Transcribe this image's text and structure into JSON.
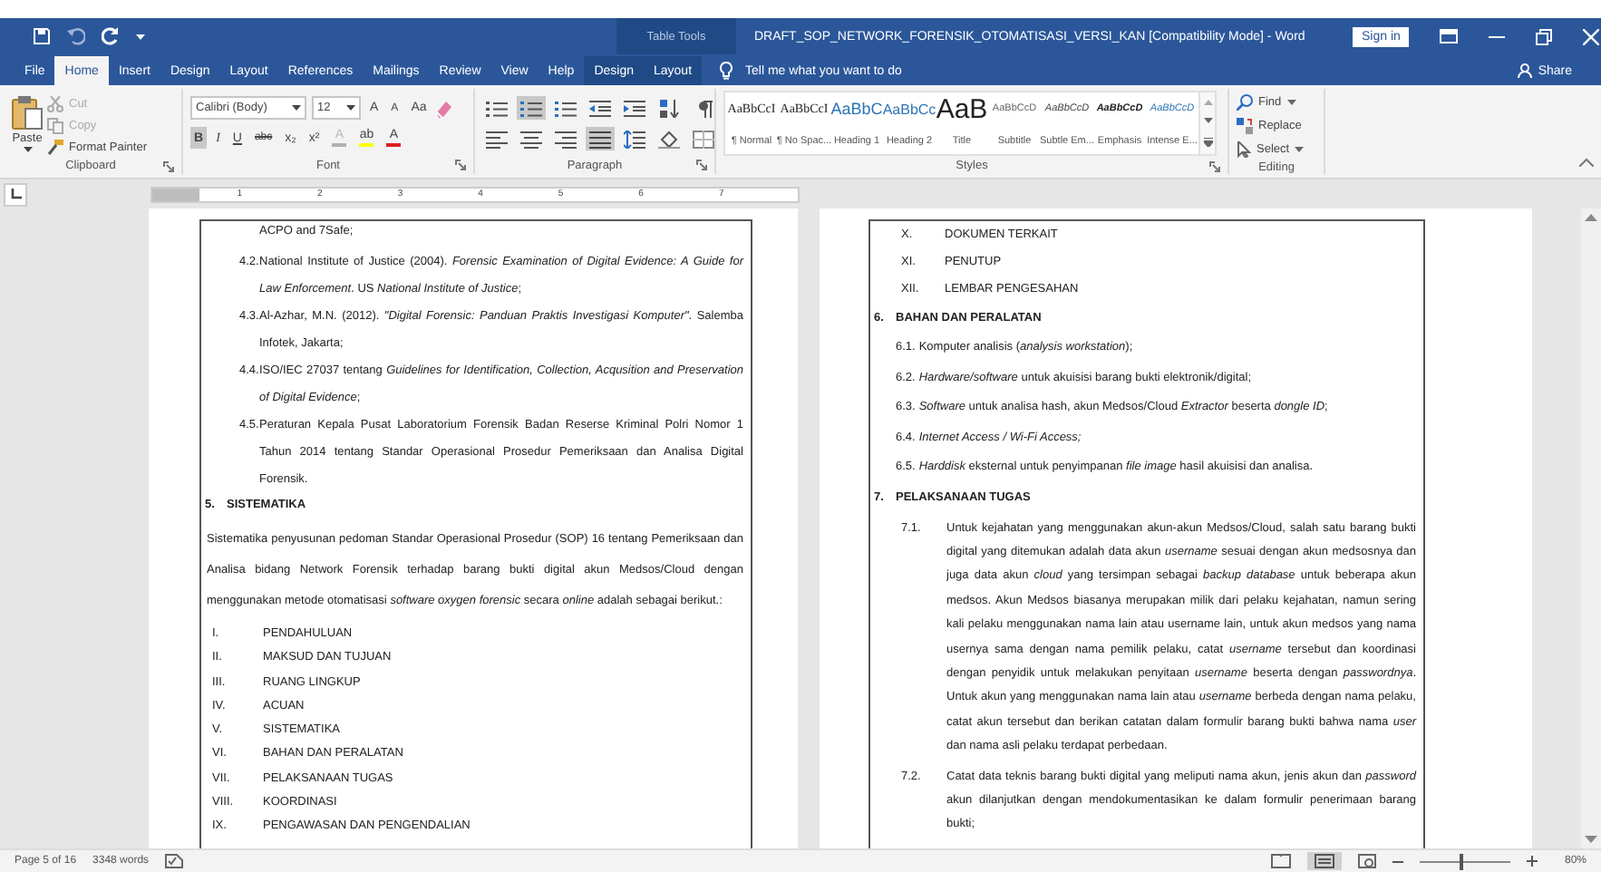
{
  "title_bar": {
    "contextual": "Table Tools",
    "title": "DRAFT_SOP_NETWORK_FORENSIK_OTOMATISASI_VERSI_KAN [Compatibility Mode]  -  Word",
    "sign_in": "Sign in"
  },
  "tabs": [
    {
      "label": "File",
      "selected": false,
      "kind": "file"
    },
    {
      "label": "Home",
      "selected": true,
      "kind": "normal"
    },
    {
      "label": "Insert",
      "selected": false,
      "kind": "normal"
    },
    {
      "label": "Design",
      "selected": false,
      "kind": "normal"
    },
    {
      "label": "Layout",
      "selected": false,
      "kind": "normal"
    },
    {
      "label": "References",
      "selected": false,
      "kind": "normal"
    },
    {
      "label": "Mailings",
      "selected": false,
      "kind": "normal"
    },
    {
      "label": "Review",
      "selected": false,
      "kind": "normal"
    },
    {
      "label": "View",
      "selected": false,
      "kind": "normal"
    },
    {
      "label": "Help",
      "selected": false,
      "kind": "normal"
    },
    {
      "label": "Design",
      "selected": false,
      "kind": "contextual"
    },
    {
      "label": "Layout",
      "selected": false,
      "kind": "contextual"
    }
  ],
  "tell_me": {
    "placeholder": "Tell me what you want to do"
  },
  "share": "Share",
  "clipboard": {
    "paste": "Paste",
    "cut": {
      "label": "Cut",
      "disabled": true
    },
    "copy": {
      "label": "Copy",
      "disabled": true
    },
    "format_painter": {
      "label": "Format Painter",
      "disabled": false
    },
    "label": "Clipboard"
  },
  "font": {
    "name": "Calibri (Body)",
    "size": "12",
    "label": "Font",
    "top_tools": [
      {
        "label": "A",
        "kind": "grow"
      },
      {
        "label": "A",
        "kind": "shrink"
      },
      {
        "label": "Aa",
        "kind": "case"
      }
    ],
    "buttons": [
      {
        "label": "B",
        "kind": "bold",
        "on": true
      },
      {
        "label": "I",
        "kind": "italic",
        "on": false
      },
      {
        "label": "U",
        "kind": "underline",
        "on": false
      },
      {
        "label": "abc",
        "kind": "strike",
        "on": false
      },
      {
        "label": "x₂",
        "kind": "sub",
        "on": false
      },
      {
        "label": "x²",
        "kind": "sup",
        "on": false
      }
    ],
    "colors": [
      {
        "label": "A",
        "kind": "effect",
        "color": "#b0b0b0"
      },
      {
        "label": "ab",
        "kind": "highlight",
        "color": "#ffff00"
      },
      {
        "label": "A",
        "kind": "fontcolor",
        "color": "#e02020"
      }
    ]
  },
  "paragraph": {
    "label": "Paragraph",
    "top": [
      {
        "kind": "bullets",
        "on": false
      },
      {
        "kind": "numbering",
        "on": true
      },
      {
        "kind": "multilevel",
        "on": false
      },
      {
        "kind": "outdent",
        "on": false
      },
      {
        "kind": "indent",
        "on": false
      },
      {
        "kind": "sort",
        "on": false
      },
      {
        "kind": "pilcrow",
        "on": false
      }
    ],
    "bottom": [
      {
        "kind": "left",
        "on": false
      },
      {
        "kind": "center",
        "on": false
      },
      {
        "kind": "right",
        "on": false
      },
      {
        "kind": "justify",
        "on": true
      },
      {
        "kind": "spacing",
        "on": false
      },
      {
        "kind": "shading",
        "on": false
      },
      {
        "kind": "borders",
        "on": false
      }
    ]
  },
  "styles": {
    "label": "Styles",
    "items": [
      {
        "preview": "AaBbCcI",
        "name": "¶ Normal",
        "kind": "normal"
      },
      {
        "preview": "AaBbCcI",
        "name": "¶ No Spac...",
        "kind": "normal"
      },
      {
        "preview": "AaBbC",
        "name": "Heading 1",
        "kind": "heading1"
      },
      {
        "preview": "AaBbCc",
        "name": "Heading 2",
        "kind": "heading2"
      },
      {
        "preview": "AaB",
        "name": "Title",
        "kind": "title"
      },
      {
        "preview": "AaBbCcD",
        "name": "Subtitle",
        "kind": "subtitle"
      },
      {
        "preview": "AaBbCcD",
        "name": "Subtle Em...",
        "kind": "subtle"
      },
      {
        "preview": "AaBbCcD",
        "name": "Emphasis",
        "kind": "emphasis"
      },
      {
        "preview": "AaBbCcD",
        "name": "Intense E...",
        "kind": "intense"
      }
    ]
  },
  "editing": {
    "label": "Editing",
    "find": "Find",
    "replace": "Replace",
    "select": "Select"
  },
  "ruler": [
    "1",
    "2",
    "3",
    "4",
    "5",
    "6",
    "7"
  ],
  "left_page": [
    {
      "kind": "cont",
      "text": "ACPO and 7Safe;"
    },
    {
      "kind": "ref",
      "number": "4.2.",
      "text": "National Institute of Justice (2004). *Forensic Examination of Digital Evidence: A Guide for Law Enforcement*. US *National Institute of Justice*;"
    },
    {
      "kind": "ref",
      "number": "4.3.",
      "text": "Al-Azhar, M.N. (2012). *\"Digital Forensic: Panduan Praktis Investigasi Komputer\"*. Salemba Infotek, Jakarta;"
    },
    {
      "kind": "ref",
      "number": "4.4.",
      "text": "ISO/IEC 27037 tentang *Guidelines for Identification, Collection, Acqusition and Preservation of Digital Evidence*;"
    },
    {
      "kind": "ref",
      "number": "4.5.",
      "text": "Peraturan Kepala Pusat Laboratorium Forensik Badan Reserse Kriminal Polri Nomor 1 Tahun 2014 tentang Standar Operasional Prosedur Pemeriksaan dan Analisa Digital Forensik."
    },
    {
      "kind": "heading",
      "number": "5.",
      "text": "SISTEMATIKA"
    },
    {
      "kind": "para",
      "text": "Sistematika penyusunan pedoman Standar Operasional Prosedur (SOP) 16 tentang Pemeriksaan dan Analisa bidang Network Forensik terhadap barang bukti digital akun Medsos/Cloud dengan menggunakan metode otomatisasi *software oxygen forensic* secara *online* adalah sebagai berikut.:"
    },
    {
      "kind": "roman",
      "number": "I.",
      "text": "PENDAHULUAN"
    },
    {
      "kind": "roman",
      "number": "II.",
      "text": "MAKSUD DAN TUJUAN"
    },
    {
      "kind": "roman",
      "number": "III.",
      "text": "RUANG LINGKUP"
    },
    {
      "kind": "roman",
      "number": "IV.",
      "text": "ACUAN"
    },
    {
      "kind": "roman",
      "number": "V.",
      "text": "SISTEMATIKA"
    },
    {
      "kind": "roman",
      "number": "VI.",
      "text": "BAHAN DAN PERALATAN"
    },
    {
      "kind": "roman",
      "number": "VII.",
      "text": "PELAKSANAAN TUGAS"
    },
    {
      "kind": "roman",
      "number": "VIII.",
      "text": "KOORDINASI"
    },
    {
      "kind": "roman",
      "number": "IX.",
      "text": "PENGAWASAN DAN PENGENDALIAN"
    }
  ],
  "right_page": [
    {
      "kind": "roman",
      "number": "X.",
      "text": "DOKUMEN TERKAIT"
    },
    {
      "kind": "roman",
      "number": "XI.",
      "text": "PENUTUP"
    },
    {
      "kind": "roman",
      "number": "XII.",
      "text": "LEMBAR PENGESAHAN"
    },
    {
      "kind": "heading",
      "number": "6.",
      "text": "BAHAN DAN PERALATAN"
    },
    {
      "kind": "point",
      "number": "6.1.",
      "text": "Komputer analisis (*analysis workstation*);",
      "italic": false
    },
    {
      "kind": "point",
      "number": "6.2.",
      "text": "*Hardware/software* untuk akuisisi barang bukti elektronik/digital;",
      "italic": false
    },
    {
      "kind": "point",
      "number": "6.3.",
      "text": "*Software* untuk analisa hash, akun Medsos/Cloud *Extractor* beserta *dongle ID*;",
      "italic": false
    },
    {
      "kind": "point",
      "number": "6.4.",
      "text": "Internet Access / Wi-Fi Access;",
      "italic": true
    },
    {
      "kind": "point",
      "number": "6.5.",
      "text": "*Harddisk* eksternal untuk penyimpanan *file image* hasil akuisisi dan analisa.",
      "italic": false
    },
    {
      "kind": "heading",
      "number": "7.",
      "text": "PELAKSANAAN TUGAS"
    },
    {
      "kind": "ref",
      "number": "7.1.",
      "text": "Untuk kejahatan yang menggunakan akun-akun Medsos/Cloud, salah satu barang bukti digital yang ditemukan adalah data akun *username* sesuai dengan akun medsosnya dan juga data akun *cloud* yang tersimpan sebagai *backup database* untuk beberapa akun medsos. Akun Medsos biasanya merupakan milik dari pelaku kejahatan, namun sering kali pelaku menggunakan nama lain atau username lain, untuk akun medsos yang nama usernya sama dengan nama pemilik pelaku, catat *username* tersebut dan koordinasi dengan penyidik untuk melakukan penyitaan *username* beserta dengan *passwordnya*. Untuk akun yang menggunakan nama lain atau *username* berbeda dengan nama pelaku, catat akun tersebut dan berikan catatan dalam formulir barang bukti bahwa nama *user* dan nama asli pelaku terdapat perbedaan."
    },
    {
      "kind": "ref",
      "number": "7.2.",
      "text": "Catat data teknis barang bukti digital yang meliputi nama akun, jenis akun dan *password* akun dilanjutkan dengan mendokumentasikan ke dalam formulir penerimaan barang bukti;"
    }
  ],
  "status_bar": {
    "page": "Page 5 of 16",
    "words": "3348 words",
    "zoom": "80%",
    "zoom_level": {
      "level": 0.45
    }
  }
}
